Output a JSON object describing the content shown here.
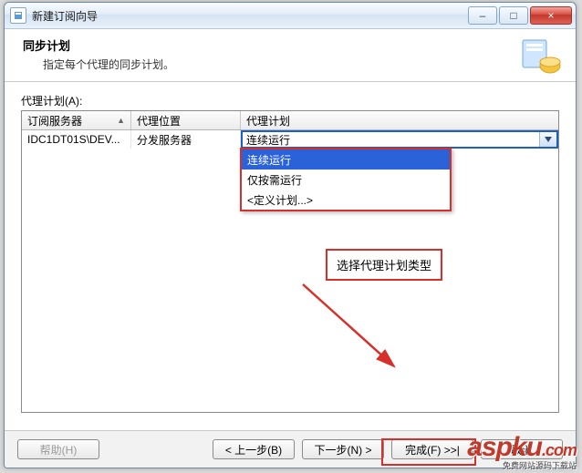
{
  "window": {
    "title": "新建订阅向导",
    "minimize": "–",
    "maximize": "□",
    "close": "×"
  },
  "header": {
    "title": "同步计划",
    "subtitle": "指定每个代理的同步计划。"
  },
  "field_label": "代理计划(A):",
  "grid": {
    "columns": [
      "订阅服务器",
      "代理位置",
      "代理计划"
    ],
    "row": {
      "server": "IDC1DT01S\\DEV...",
      "location": "分发服务器",
      "schedule_selected": "连续运行"
    }
  },
  "dropdown": {
    "options": [
      "连续运行",
      "仅按需运行",
      "<定义计划...>"
    ],
    "selected_index": 0
  },
  "callout": "选择代理计划类型",
  "buttons": {
    "help": "帮助(H)",
    "back": "< 上一步(B)",
    "next": "下一步(N) >",
    "finish": "完成(F) >>|",
    "cancel": "取消"
  },
  "watermark": {
    "main": "aspku",
    "dot": ".com",
    "sub": "免费网站源码下载站"
  }
}
